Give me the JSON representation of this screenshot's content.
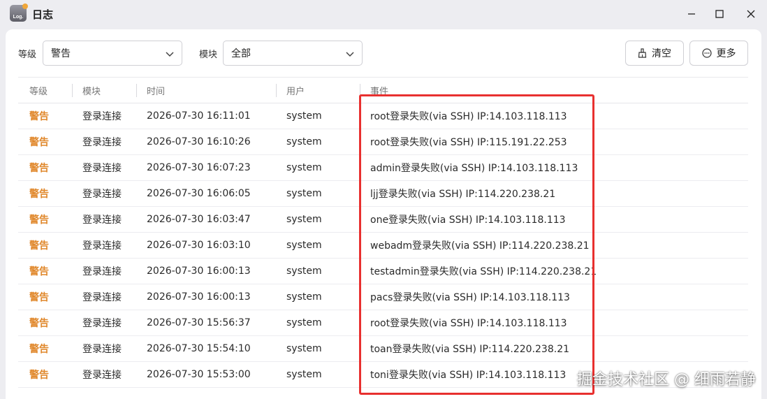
{
  "window": {
    "title": "日志",
    "icon_text": "Log.",
    "controls": [
      "minimize-icon",
      "maximize-icon",
      "close-icon"
    ]
  },
  "filters": {
    "level_label": "等级",
    "level_value": "警告",
    "module_label": "模块",
    "module_value": "全部"
  },
  "actions": {
    "clear_label": "清空",
    "more_label": "更多"
  },
  "table": {
    "columns": [
      "等级",
      "模块",
      "时间",
      "用户",
      "事件"
    ],
    "rows": [
      {
        "level": "警告",
        "module": "登录连接",
        "time": "2026-07-30 16:11:01",
        "user": "system",
        "event": "root登录失败(via SSH) IP:14.103.118.113"
      },
      {
        "level": "警告",
        "module": "登录连接",
        "time": "2026-07-30 16:10:26",
        "user": "system",
        "event": "root登录失败(via SSH) IP:115.191.22.253"
      },
      {
        "level": "警告",
        "module": "登录连接",
        "time": "2026-07-30 16:07:23",
        "user": "system",
        "event": "admin登录失败(via SSH) IP:14.103.118.113"
      },
      {
        "level": "警告",
        "module": "登录连接",
        "time": "2026-07-30 16:06:05",
        "user": "system",
        "event": "ljj登录失败(via SSH) IP:114.220.238.21"
      },
      {
        "level": "警告",
        "module": "登录连接",
        "time": "2026-07-30 16:03:47",
        "user": "system",
        "event": "one登录失败(via SSH) IP:14.103.118.113"
      },
      {
        "level": "警告",
        "module": "登录连接",
        "time": "2026-07-30 16:03:10",
        "user": "system",
        "event": "webadm登录失败(via SSH) IP:114.220.238.21"
      },
      {
        "level": "警告",
        "module": "登录连接",
        "time": "2026-07-30 16:00:13",
        "user": "system",
        "event": "testadmin登录失败(via SSH) IP:114.220.238.21"
      },
      {
        "level": "警告",
        "module": "登录连接",
        "time": "2026-07-30 16:00:13",
        "user": "system",
        "event": "pacs登录失败(via SSH) IP:14.103.118.113"
      },
      {
        "level": "警告",
        "module": "登录连接",
        "time": "2026-07-30 15:56:37",
        "user": "system",
        "event": "root登录失败(via SSH) IP:14.103.118.113"
      },
      {
        "level": "警告",
        "module": "登录连接",
        "time": "2026-07-30 15:54:10",
        "user": "system",
        "event": "toan登录失败(via SSH) IP:114.220.238.21"
      },
      {
        "level": "警告",
        "module": "登录连接",
        "time": "2026-07-30 15:53:00",
        "user": "system",
        "event": "toni登录失败(via SSH) IP:14.103.118.113"
      }
    ]
  },
  "colors": {
    "warning": "#e0872a",
    "highlight": "#e8302f"
  },
  "watermark": "掘金技术社区 @ 细雨若静"
}
